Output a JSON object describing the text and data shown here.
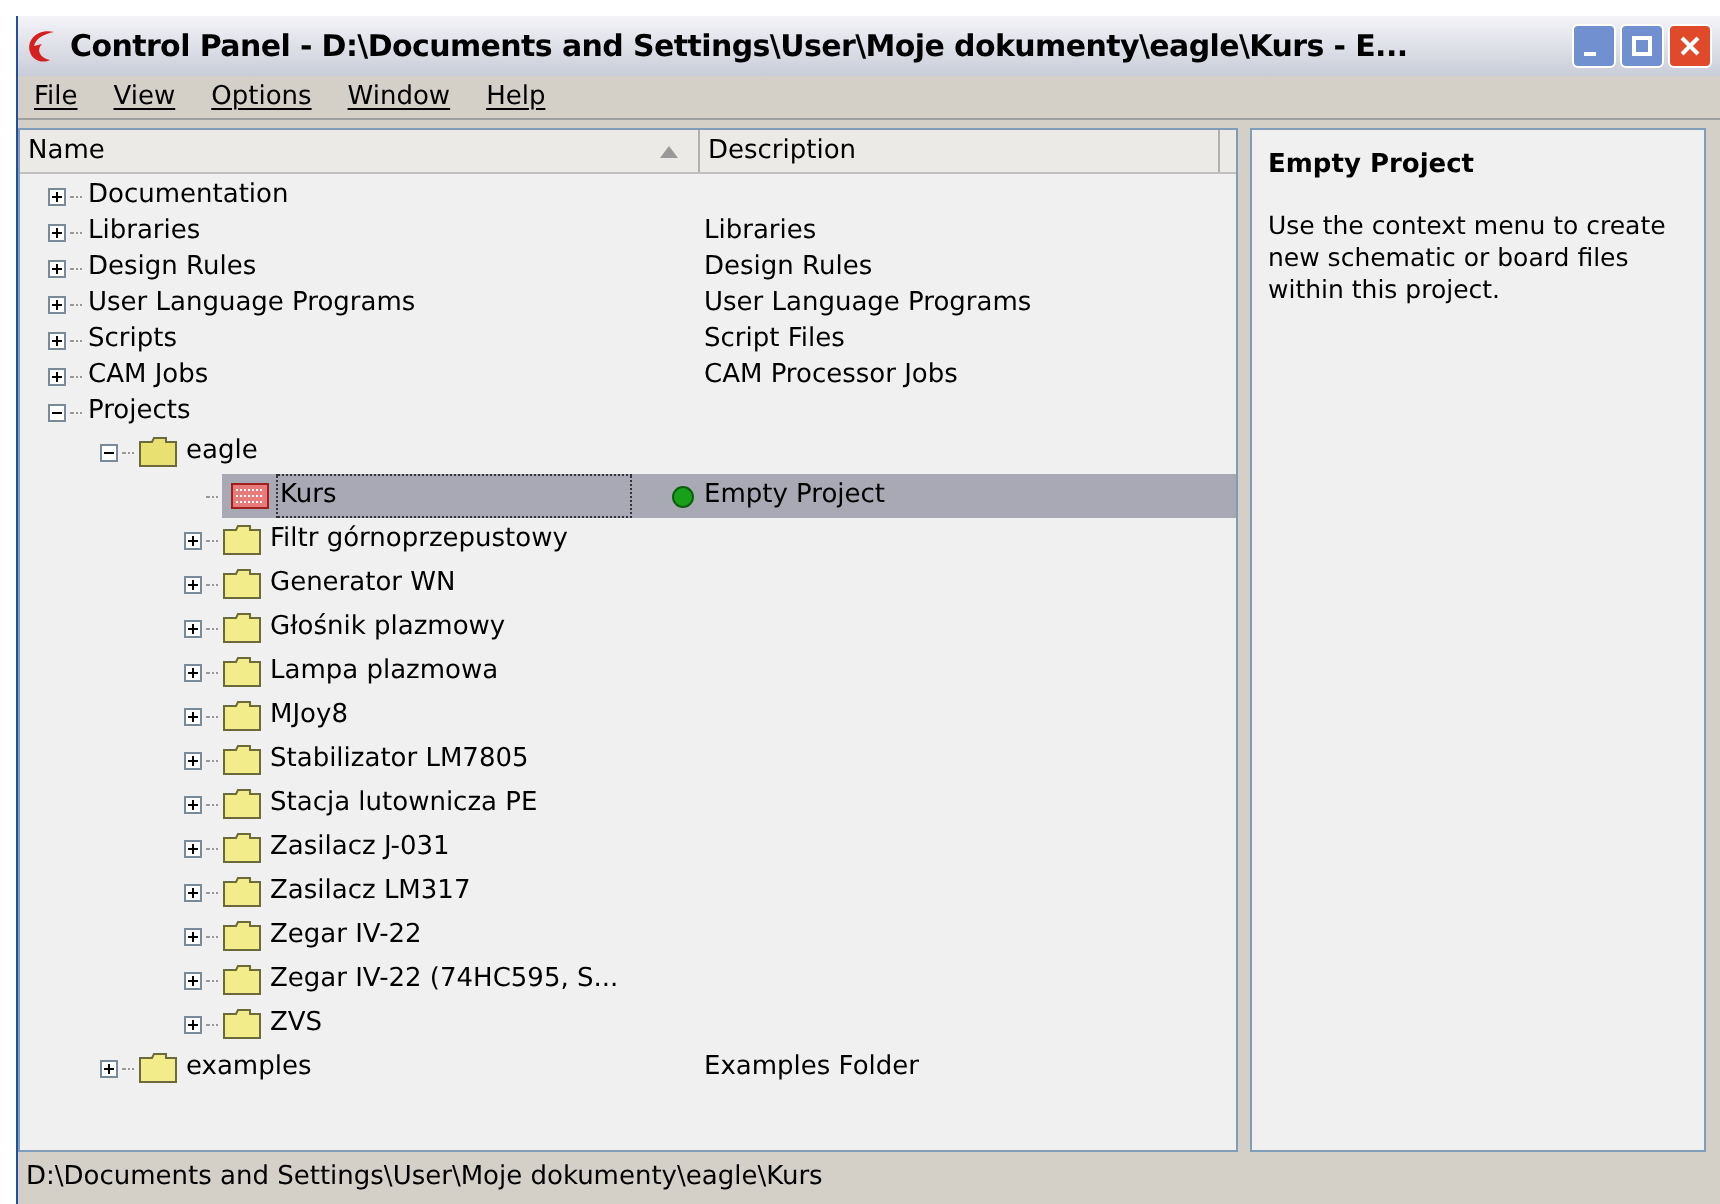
{
  "window": {
    "title": "Control Panel - D:\\Documents and Settings\\User\\Moje dokumenty\\eagle\\Kurs - E..."
  },
  "menu": [
    "File",
    "View",
    "Options",
    "Window",
    "Help"
  ],
  "columns": [
    {
      "label": "Name",
      "sorted": true
    },
    {
      "label": "Description",
      "sorted": false
    }
  ],
  "tree": [
    {
      "kind": "category",
      "name": "Documentation",
      "expanded": false,
      "selected": false
    },
    {
      "kind": "category",
      "name": "Libraries",
      "description": "Libraries",
      "expanded": false,
      "selected": false
    },
    {
      "kind": "category",
      "name": "Design Rules",
      "description": "Design Rules",
      "expanded": false,
      "selected": false
    },
    {
      "kind": "category",
      "name": "User Language Programs",
      "description": "User Language Programs",
      "expanded": false,
      "selected": false
    },
    {
      "kind": "category",
      "name": "Scripts",
      "description": "Script Files",
      "expanded": false,
      "selected": false
    },
    {
      "kind": "category",
      "name": "CAM Jobs",
      "description": "CAM Processor Jobs",
      "expanded": false,
      "selected": false
    },
    {
      "kind": "category",
      "name": "Projects",
      "expanded": true,
      "selected": false,
      "children": [
        {
          "kind": "folder",
          "name": "eagle",
          "expanded": true,
          "selected": false,
          "children": [
            {
              "kind": "project",
              "name": "Kurs",
              "description": "Empty Project",
              "active": true,
              "selected": true
            },
            {
              "kind": "folder",
              "name": "Filtr górnoprzepustowy",
              "expanded": false,
              "selected": false
            },
            {
              "kind": "folder",
              "name": "Generator WN",
              "expanded": false,
              "selected": false
            },
            {
              "kind": "folder",
              "name": "Głośnik plazmowy",
              "expanded": false,
              "selected": false
            },
            {
              "kind": "folder",
              "name": "Lampa plazmowa",
              "expanded": false,
              "selected": false
            },
            {
              "kind": "folder",
              "name": "MJoy8",
              "expanded": false,
              "selected": false
            },
            {
              "kind": "folder",
              "name": "Stabilizator LM7805",
              "expanded": false,
              "selected": false
            },
            {
              "kind": "folder",
              "name": "Stacja lutownicza PE",
              "expanded": false,
              "selected": false
            },
            {
              "kind": "folder",
              "name": "Zasilacz J-031",
              "expanded": false,
              "selected": false
            },
            {
              "kind": "folder",
              "name": "Zasilacz LM317",
              "expanded": false,
              "selected": false
            },
            {
              "kind": "folder",
              "name": "Zegar IV-22",
              "expanded": false,
              "selected": false
            },
            {
              "kind": "folder",
              "name": "Zegar IV-22 (74HC595, S...",
              "expanded": false,
              "selected": false
            },
            {
              "kind": "folder",
              "name": "ZVS",
              "expanded": false,
              "selected": false
            }
          ]
        },
        {
          "kind": "folder",
          "name": "examples",
          "description": "Examples Folder",
          "expanded": false,
          "selected": false
        }
      ]
    }
  ],
  "info": {
    "title": "Empty Project",
    "text": "Use the context menu to create new schematic or board files within this project."
  },
  "status_bar": "D:\\Documents and Settings\\User\\Moje dokumenty\\eagle\\Kurs"
}
